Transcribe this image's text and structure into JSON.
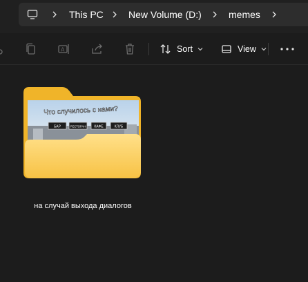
{
  "breadcrumb": {
    "items": [
      "This PC",
      "New Volume (D:)",
      "memes"
    ]
  },
  "toolbar": {
    "sort_label": "Sort",
    "view_label": "View"
  },
  "folder": {
    "name": "на случай выхода диалогов",
    "thumbnail": {
      "caption": "Что случилось с нами?",
      "signs": [
        "БАР",
        "РЕСТОРАН",
        "КАФЕ",
        "КЛУБ"
      ]
    }
  },
  "colors": {
    "background": "#1c1c1c",
    "address_bar": "#2d2d2d",
    "folder_back": "#f0b429",
    "folder_front": "#ffd561",
    "accent": "#60cdff"
  },
  "icons": [
    "monitor-icon",
    "chevron-right-icon",
    "copy-icon",
    "rename-icon",
    "share-icon",
    "delete-icon",
    "sort-icon",
    "view-icon",
    "more-icon"
  ]
}
